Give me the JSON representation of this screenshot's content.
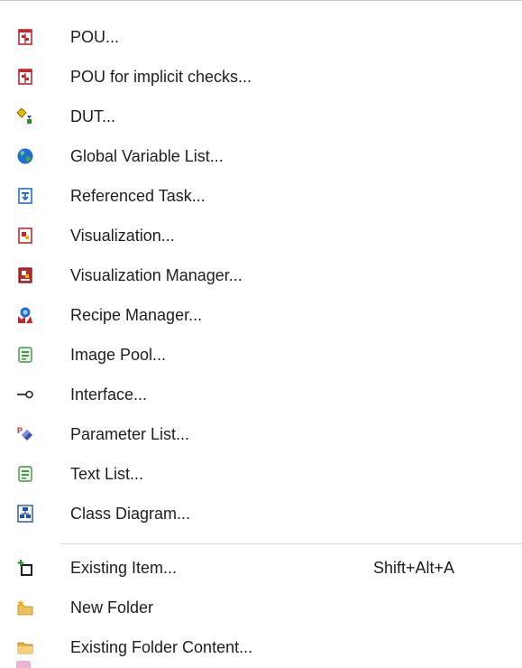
{
  "menu": {
    "items": [
      {
        "label": "POU...",
        "icon": "pou-icon"
      },
      {
        "label": "POU for implicit checks...",
        "icon": "pou-implicit-checks-icon"
      },
      {
        "label": "DUT...",
        "icon": "dut-icon"
      },
      {
        "label": "Global Variable List...",
        "icon": "globe-icon"
      },
      {
        "label": "Referenced Task...",
        "icon": "referenced-task-icon"
      },
      {
        "label": "Visualization...",
        "icon": "visualization-icon"
      },
      {
        "label": "Visualization Manager...",
        "icon": "visualization-manager-icon"
      },
      {
        "label": "Recipe Manager...",
        "icon": "recipe-manager-icon"
      },
      {
        "label": "Image Pool...",
        "icon": "image-pool-icon"
      },
      {
        "label": "Interface...",
        "icon": "interface-icon"
      },
      {
        "label": "Parameter List...",
        "icon": "parameter-list-icon"
      },
      {
        "label": "Text List...",
        "icon": "text-list-icon"
      },
      {
        "label": "Class Diagram...",
        "icon": "class-diagram-icon"
      },
      {
        "label": "Existing Item...",
        "icon": "existing-item-icon",
        "shortcut": "Shift+Alt+A"
      },
      {
        "label": "New Folder",
        "icon": "new-folder-icon"
      },
      {
        "label": "Existing Folder Content...",
        "icon": "existing-folder-icon"
      }
    ]
  },
  "colors": {
    "text": "#1e1e1e",
    "separator": "#d6d6d6",
    "pou_red": "#c0282d",
    "dut_yellow": "#e8b800",
    "globe_blue": "#1f6fd1",
    "folder_yellow": "#e9c25a"
  }
}
